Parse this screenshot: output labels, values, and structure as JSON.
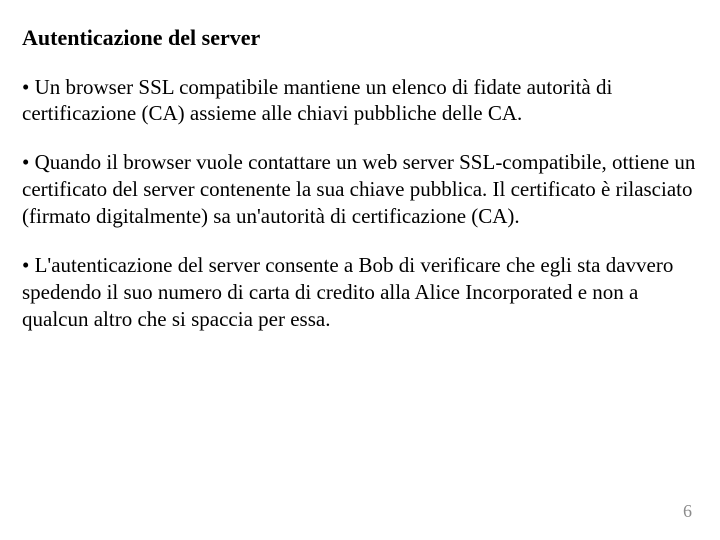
{
  "title": "Autenticazione del server",
  "bullets": [
    "Un browser SSL compatibile mantiene un elenco di fidate autorità  di certificazione (CA) assieme alle chiavi pubbliche delle CA.",
    "Quando il browser vuole contattare un web server SSL-compatibile, ottiene un certificato del server contenente la sua chiave pubblica. Il certificato è rilasciato (firmato digitalmente) sa un'autorità di certificazione (CA).",
    "L'autenticazione del server consente a Bob di verificare che egli sta davvero spedendo il suo numero di carta di credito alla Alice Incorporated e non a qualcun altro che si spaccia per essa."
  ],
  "bullet_symbol": "•",
  "page_number": "6"
}
